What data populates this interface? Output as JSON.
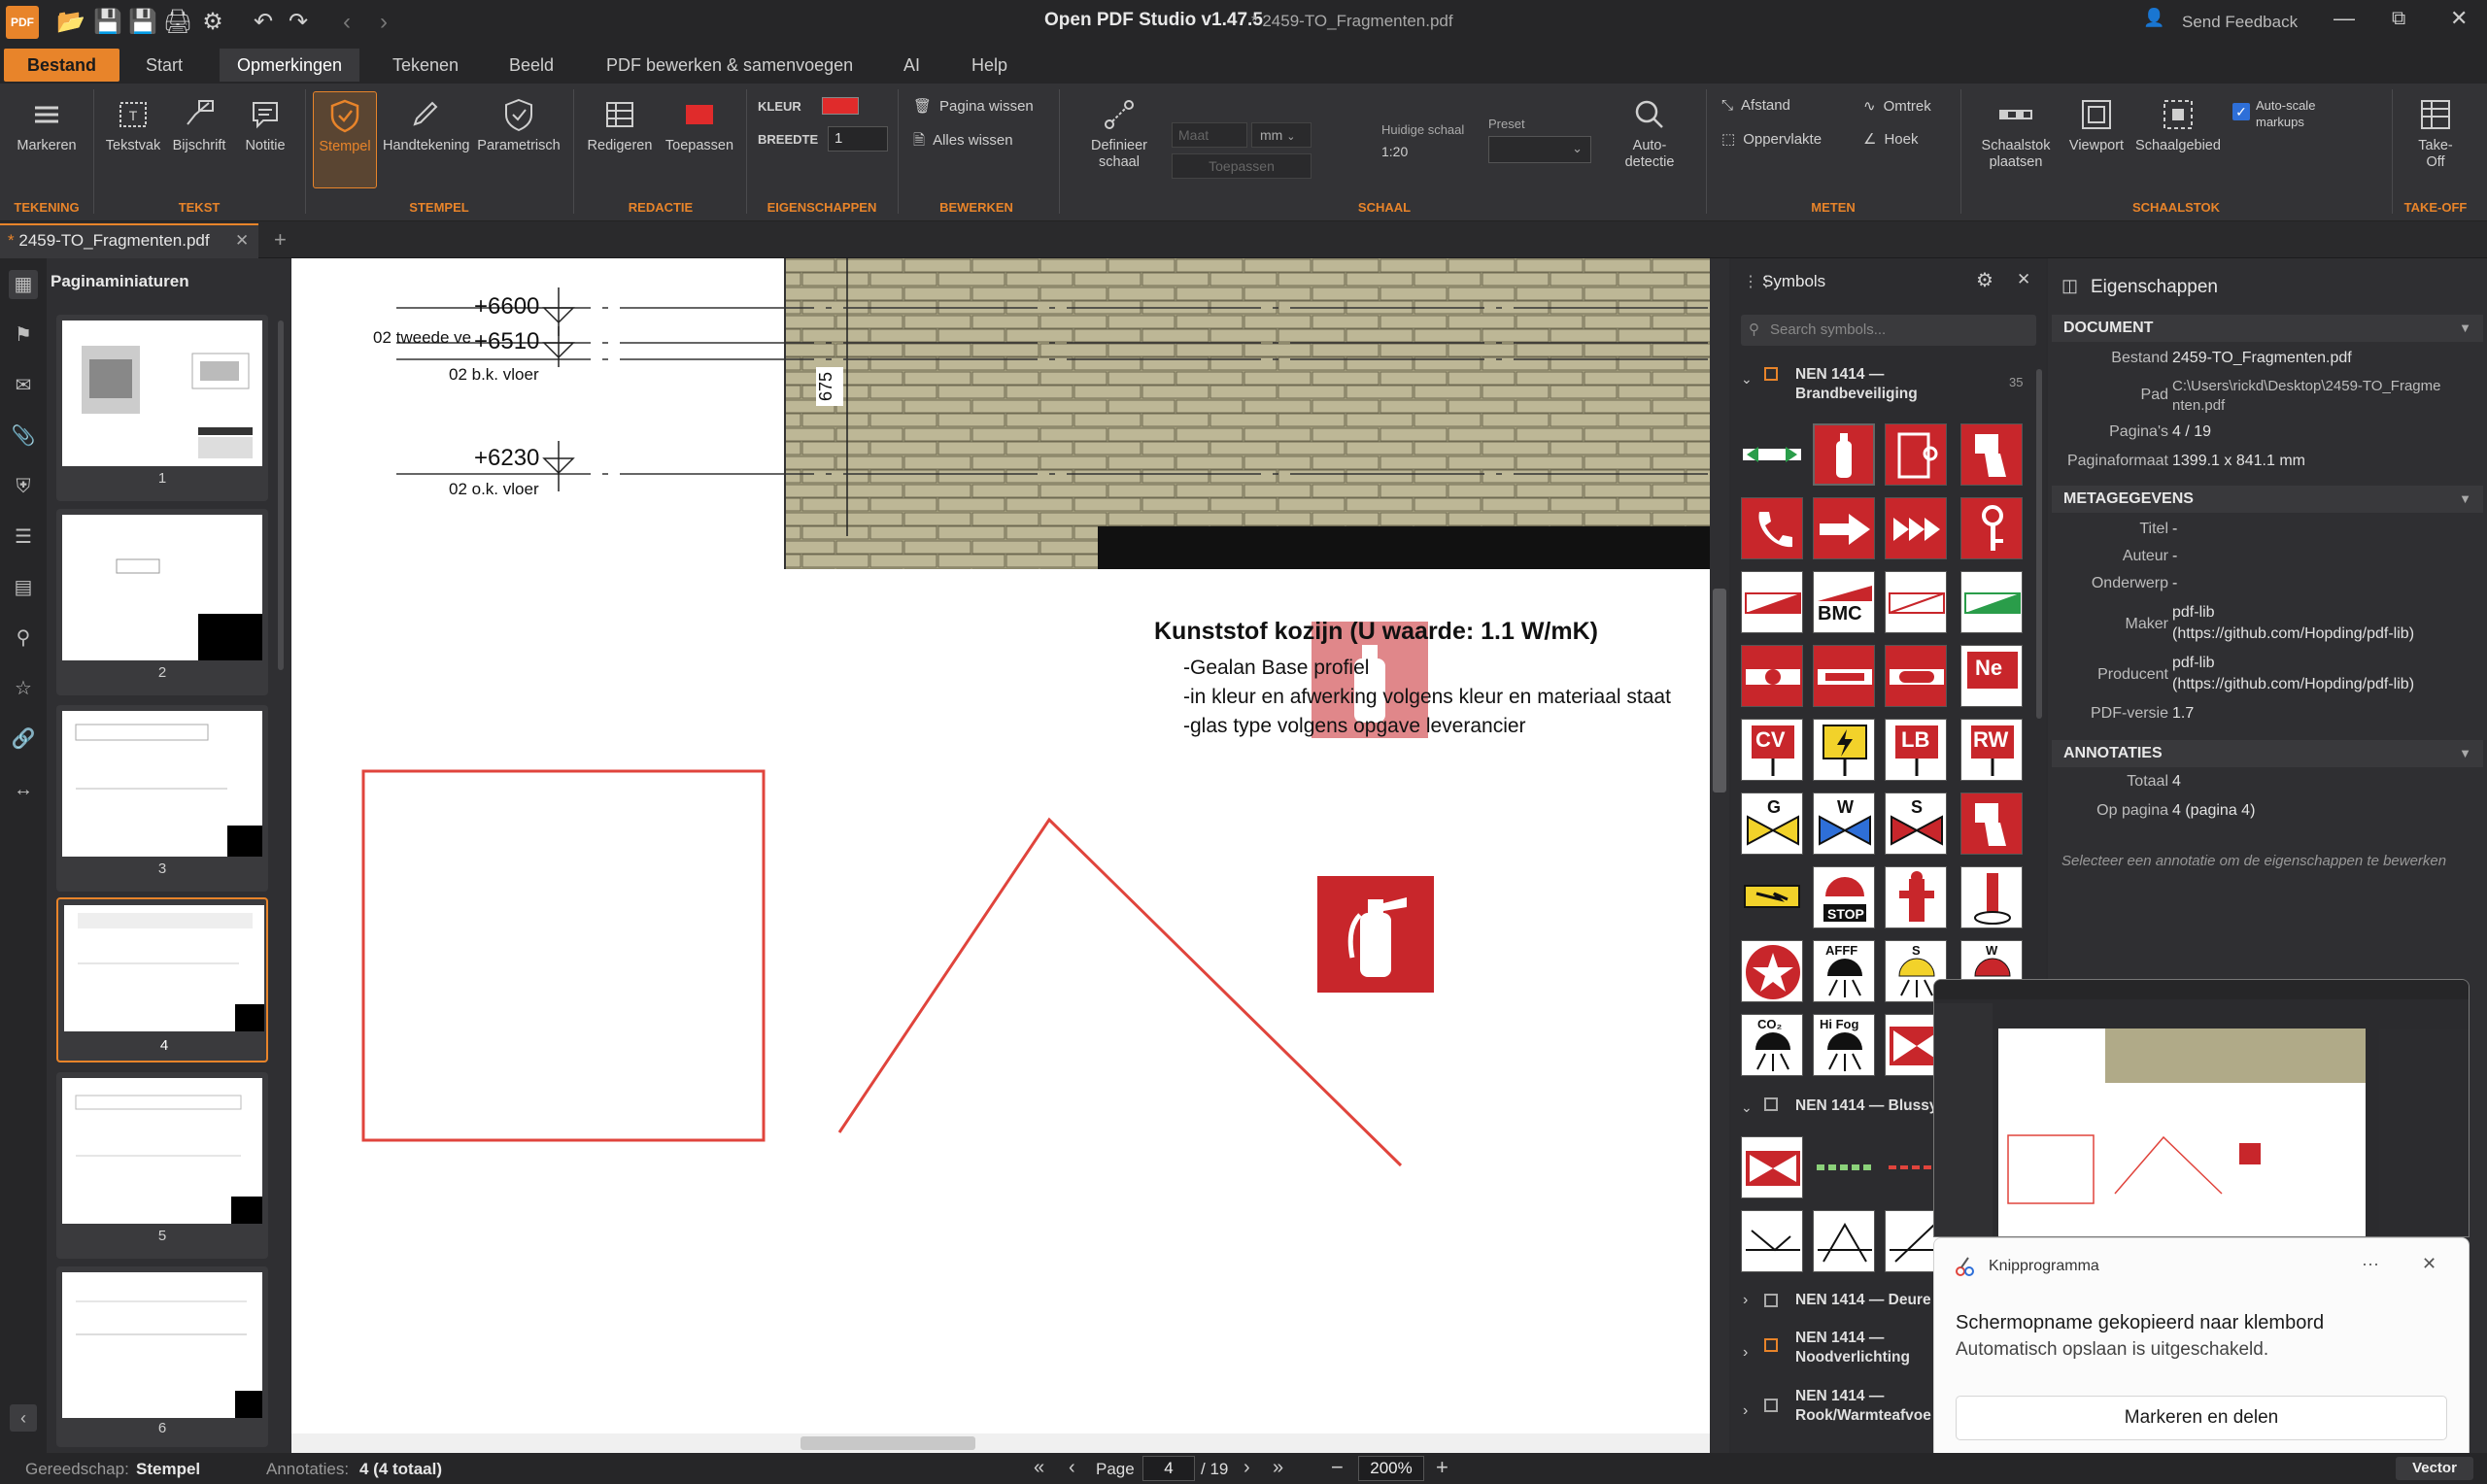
{
  "titlebar": {
    "app_title": "Open PDF Studio v1.47.5",
    "file_title": "* 2459-TO_Fragmenten.pdf",
    "send_feedback": "Send Feedback"
  },
  "menu": {
    "tabs": [
      "Bestand",
      "Start",
      "Opmerkingen",
      "Tekenen",
      "Beeld",
      "PDF bewerken & samenvoegen",
      "AI",
      "Help"
    ]
  },
  "ribbon": {
    "markeren": "Markeren",
    "tekstvak": "Tekstvak",
    "bijschrift": "Bijschrift",
    "notitie": "Notitie",
    "stempel": "Stempel",
    "handtekening": "Handtekening",
    "parametrisch": "Parametrisch",
    "redigeren": "Redigeren",
    "toepassen": "Toepassen",
    "kleur_label": "KLEUR",
    "breedte_label": "BREEDTE",
    "breedte_value": "1",
    "pagina_wissen": "Pagina wissen",
    "alles_wissen": "Alles wissen",
    "definieer_schaal_1": "Definieer",
    "definieer_schaal_2": "schaal",
    "maat_placeholder": "Maat",
    "unit": "mm",
    "toepassen_schaal": "Toepassen",
    "huidige_schaal_label": "Huidige schaal",
    "huidige_schaal_value": "1:20",
    "preset_label": "Preset",
    "autodetectie_1": "Auto-",
    "autodetectie_2": "detectie",
    "afstand": "Afstand",
    "omtrek": "Omtrek",
    "oppervlakte": "Oppervlakte",
    "hoek": "Hoek",
    "schaalstok_1": "Schaalstok",
    "schaalstok_2": "plaatsen",
    "viewport": "Viewport",
    "schaalgebied": "Schaalgebied",
    "autoscale_1": "Auto-scale",
    "autoscale_2": "markups",
    "takeoff_1": "Take-",
    "takeoff_2": "Off",
    "groups": {
      "tekening": "TEKENING",
      "tekst": "TEKST",
      "stempel": "STEMPEL",
      "redactie": "REDACTIE",
      "eigenschappen": "EIGENSCHAPPEN",
      "bewerken": "BEWERKEN",
      "schaal": "SCHAAL",
      "meten": "METEN",
      "schaalstok": "SCHAALSTOK",
      "takeoff": "TAKE-OFF"
    },
    "colors": {
      "accent": "#e8842a",
      "kleur_swatch": "#e02b2b"
    }
  },
  "doc_tab": {
    "label": "2459-TO_Fragmenten.pdf",
    "modified_marker": "*"
  },
  "thumbnails": {
    "title": "Paginaminiaturen",
    "pages": [
      "1",
      "2",
      "3",
      "4",
      "5",
      "6"
    ],
    "selected": "4"
  },
  "canvas": {
    "elevations": [
      {
        "value": "+6600",
        "label": "02 tweede ve"
      },
      {
        "value": "+6510",
        "label": "02 b.k. vloer"
      },
      {
        "value": "+6230",
        "label": "02 o.k. vloer"
      }
    ],
    "dimension": "675",
    "heading": "Kunststof kozijn (U waarde: 1.1 W/mK)",
    "lines": [
      "-Gealan Base profiel",
      "-in kleur en afwerking volgens kleur en materiaal staat",
      "-glas type volgens opgave leverancier"
    ]
  },
  "symbols": {
    "title": "Symbols",
    "search_placeholder": "Search symbols...",
    "groups": [
      {
        "line1": "NEN 1414 —",
        "line2": "Brandbeveiliging",
        "count": "35",
        "expanded": true
      },
      {
        "line1": "NEN 1414 — Blussy",
        "line2": "",
        "count": "",
        "expanded": true
      },
      {
        "line1": "NEN 1414 — Deure",
        "line2": "",
        "count": "",
        "expanded": false
      },
      {
        "line1": "NEN 1414 —",
        "line2": "Noodverlichting",
        "count": "",
        "expanded": false
      },
      {
        "line1": "NEN 1414 —",
        "line2": "Rook/Warmteafvoe",
        "count": "",
        "expanded": false
      }
    ],
    "tile_texts": [
      "BMC",
      "Ne",
      "CV",
      "LB",
      "RW",
      "G",
      "W",
      "S",
      "STOP",
      "AFFF",
      "S",
      "W",
      "CO₂",
      "Hi Fog"
    ]
  },
  "properties": {
    "title": "Eigenschappen",
    "document_header": "DOCUMENT",
    "bestand_label": "Bestand",
    "bestand_value": "2459-TO_Fragmenten.pdf",
    "pad_label": "Pad",
    "pad_value_1": "C:\\Users\\rickd\\Desktop\\2459-TO_Fragme",
    "pad_value_2": "nten.pdf",
    "paginas_label": "Pagina's",
    "paginas_value": "4 / 19",
    "paginaformaat_label": "Paginaformaat",
    "paginaformaat_value": "1399.1 x 841.1 mm",
    "metagegevens_header": "METAGEGEVENS",
    "titel_label": "Titel",
    "titel_value": "-",
    "auteur_label": "Auteur",
    "auteur_value": "-",
    "onderwerp_label": "Onderwerp",
    "onderwerp_value": "-",
    "maker_label": "Maker",
    "maker_value_1": "pdf-lib",
    "maker_value_2": "(https://github.com/Hopding/pdf-lib)",
    "producent_label": "Producent",
    "producent_value_1": "pdf-lib",
    "producent_value_2": "(https://github.com/Hopding/pdf-lib)",
    "pdfversie_label": "PDF-versie",
    "pdfversie_value": "1.7",
    "annotaties_header": "ANNOTATIES",
    "totaal_label": "Totaal",
    "totaal_value": "4",
    "oppagina_label": "Op pagina",
    "oppagina_value": "4 (pagina 4)",
    "hint": "Selecteer een annotatie om de eigenschappen te bewerken"
  },
  "status": {
    "gereedschap_label": "Gereedschap:",
    "gereedschap_value": "Stempel",
    "annotaties_label": "Annotaties:",
    "annotaties_value": "4 (4 totaal)",
    "page_label": "Page",
    "page_value": "4",
    "page_total": "/ 19",
    "zoom": "200%",
    "mode": "Vector"
  },
  "toast": {
    "app": "Knipprogramma",
    "title": "Schermopname gekopieerd naar klembord",
    "subtitle": "Automatisch opslaan is uitgeschakeld.",
    "button": "Markeren en delen",
    "more": "···"
  }
}
